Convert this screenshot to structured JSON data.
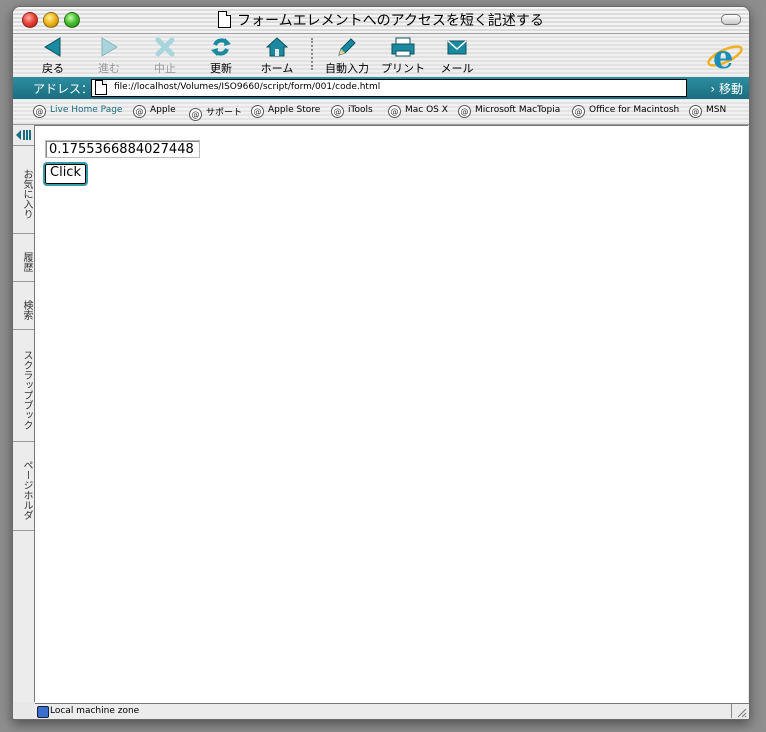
{
  "window": {
    "title": "フォームエレメントへのアクセスを短く記述する"
  },
  "toolbar": {
    "back_label": "戻る",
    "forward_label": "進む",
    "stop_label": "中止",
    "refresh_label": "更新",
    "home_label": "ホーム",
    "autofill_label": "自動入力",
    "print_label": "プリント",
    "mail_label": "メール"
  },
  "address": {
    "label": "アドレス：",
    "url": "file://localhost/Volumes/ISO9660/script/form/001/code.html",
    "go_label": "移動"
  },
  "favorites": [
    {
      "label": "Live Home Page"
    },
    {
      "label": "Apple"
    },
    {
      "label": "サポート"
    },
    {
      "label": "Apple Store"
    },
    {
      "label": "iTools"
    },
    {
      "label": "Mac OS X"
    },
    {
      "label": "Microsoft MacTopia"
    },
    {
      "label": "Office for Macintosh"
    },
    {
      "label": "MSN"
    }
  ],
  "sidebar": {
    "tabs": [
      {
        "label": "お気に入り"
      },
      {
        "label": "履歴"
      },
      {
        "label": "検索"
      },
      {
        "label": "スクラップブック"
      },
      {
        "label": "ページホルダ"
      }
    ]
  },
  "page": {
    "input_value": "0.1755366884027448",
    "button_label": "Click"
  },
  "status": {
    "zone": "Local machine zone"
  },
  "colors": {
    "accent": "#1a6e80"
  }
}
